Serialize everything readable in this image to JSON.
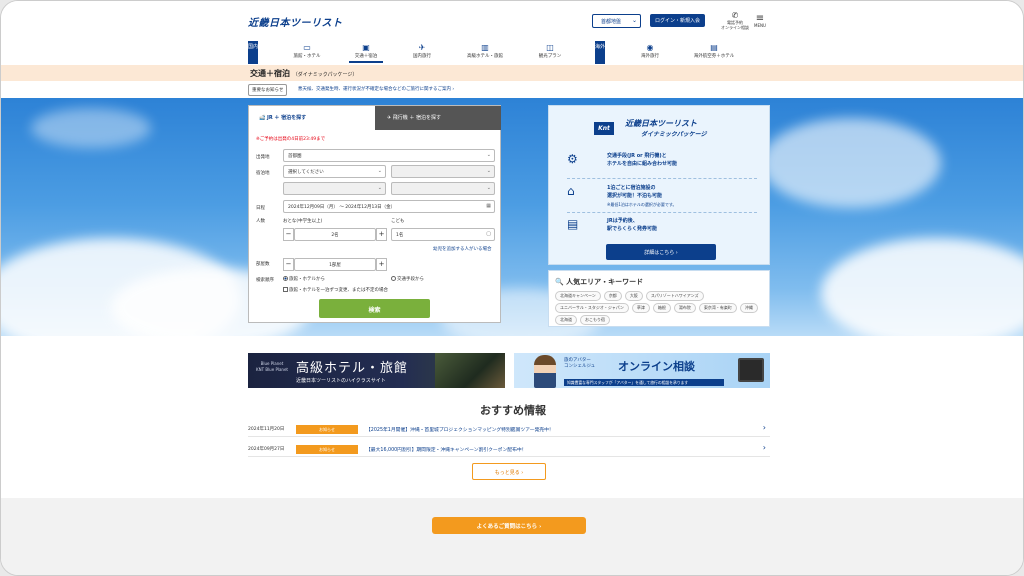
{
  "header": {
    "logo": "近畿日本ツーリスト",
    "region_select": "首都地盤",
    "login_button": "ログイン・新規入会",
    "phone_label_1": "電話予約",
    "phone_label_2": "オンライン相談",
    "menu_label": "MENU"
  },
  "nav": {
    "domestic_tag": "国内",
    "overseas_tag": "海外",
    "items": [
      {
        "label": "旅館・ホテル",
        "icon": "bed-icon"
      },
      {
        "label": "交通＋宿泊",
        "icon": "train-icon"
      },
      {
        "label": "国内旅行",
        "icon": "plane-icon"
      },
      {
        "label": "高級ホテル・旅館",
        "icon": "building-icon"
      },
      {
        "label": "観光プラン",
        "icon": "bag-icon"
      },
      {
        "label": "海外旅行",
        "icon": "globe-icon"
      },
      {
        "label": "海外航空券＋ホテル",
        "icon": "ticket-icon"
      }
    ]
  },
  "page": {
    "title": "交通＋宿泊",
    "title_sub": "（ダイナミックパッケージ）",
    "notice_button": "重要なお知らせ",
    "notice_text": "悪天候、交通発生時、運行状況が不確定な場合などのご旅行に関するご案内 ›"
  },
  "search": {
    "tab_jr": "JR ＋ 宿泊を探す",
    "tab_air": "飛行機 ＋ 宿泊を探す",
    "warning": "※ご予約は出発の4日前23:49まで",
    "departure_label": "出発地",
    "departure_value": "首都圏",
    "lodging_label": "宿泊地",
    "lodging_placeholder": "選択してください",
    "date_label": "日程",
    "date_value": "2024年12月09日（月） 〜 2024年12月13日（金）",
    "people_label": "人数",
    "adult_label": "おとな(中学生以上)",
    "adult_value": "2名",
    "child_label": "こども",
    "child_value": "1名",
    "child_link": "幼児を追加する人がいる場合",
    "rooms_label": "部屋数",
    "rooms_value": "1部屋",
    "order_label": "検索順序",
    "order_opt1": "旅館・ホテルから",
    "order_opt2": "交通手段から",
    "order_check": "旅館・ホテルを一泊ずつ変更、または不定の場合",
    "submit": "検索"
  },
  "promo": {
    "knt": "Knt",
    "brand_line1": "近畿日本ツーリスト",
    "brand_line2": "ダイナミックパッケージ",
    "point1": "交通手段(JR or 飛行機)と\nホテルを自由に組み合わせ可能",
    "point2": "1泊ごとに宿泊施設の\n選択が可能！不泊も可能",
    "point2_note": "※最低1泊はホテルの選択が必要です。",
    "point3": "JRは予約後、\n駅でらくらく発券可能",
    "detail_button": "詳細はこちら ›"
  },
  "keywords": {
    "title": "人気エリア・キーワード",
    "tags": [
      "北海道キャンペーン",
      "京都",
      "大阪",
      "スパリゾートハワイアンズ",
      "ユニバーサル・スタジオ・ジャパン",
      "草津",
      "箱根",
      "湯布院",
      "東京湾・有楽町",
      "沖縄",
      "北海道",
      "おこもり宿"
    ]
  },
  "banners": {
    "luxury_logo": "Blue Planet",
    "luxury_logo_sub": "KNT Blue Planet",
    "luxury_title": "高級ホテル・旅館",
    "luxury_sub": "近畿日本ツーリストのハイクラスサイト",
    "online_small": "旅のアバター\nコンシェルジュ",
    "online_big": "オンライン相談",
    "online_sub": "知識豊富な専門スタッフが「アバター」を通して旅行の相談を承ります"
  },
  "news": {
    "title": "おすすめ情報",
    "items": [
      {
        "date": "2024年11月20日",
        "badge": "お知らせ",
        "text": "【2025年1月開催】沖縄・首里城プロジェクションマッピング特別鑑賞ツアー発売中！"
      },
      {
        "date": "2024年09月27日",
        "badge": "お知らせ",
        "text": "【最大16,000円割引】期間限定・沖縄キャンペーン割引クーポン配布中！"
      }
    ],
    "more_button": "もっと見る ›"
  },
  "footer": {
    "faq_button": "よくあるご質問はこちら ›"
  },
  "colors": {
    "brand_blue": "#0c3f8c",
    "accent_orange": "#f39a1e",
    "submit_green": "#7ab03c"
  }
}
